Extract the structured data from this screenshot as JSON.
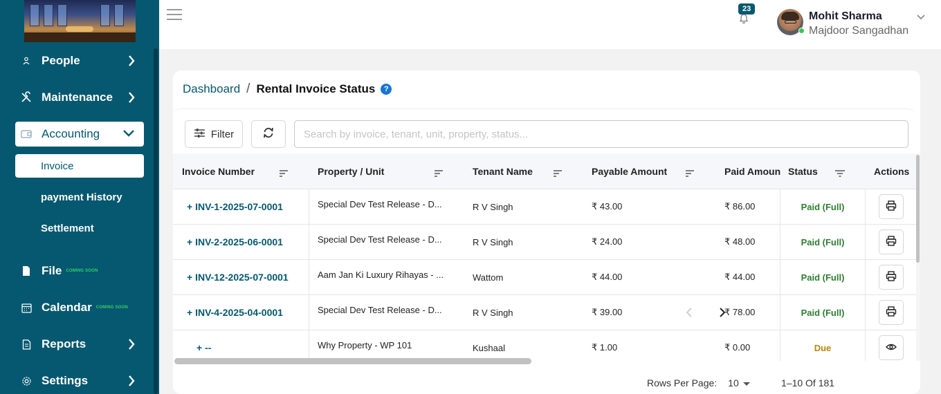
{
  "sidebar": {
    "items": [
      {
        "label": "People",
        "icon": "person-icon"
      },
      {
        "label": "Maintenance",
        "icon": "tools-icon"
      },
      {
        "label": "Accounting",
        "icon": "wallet-icon"
      },
      {
        "label": "File",
        "icon": "file-icon",
        "badge": "COMING SOON"
      },
      {
        "label": "Calendar",
        "icon": "calendar-icon",
        "badge": "COMING SOON"
      },
      {
        "label": "Reports",
        "icon": "report-icon"
      },
      {
        "label": "Settings",
        "icon": "gear-icon"
      }
    ],
    "sub_items": [
      {
        "label": "Invoice"
      },
      {
        "label": "payment History"
      },
      {
        "label": "Settlement"
      }
    ]
  },
  "header": {
    "notification_count": "23",
    "user_name": "Mohit Sharma",
    "user_org": "Majdoor Sangadhan"
  },
  "breadcrumb": {
    "root": "Dashboard",
    "separator": "/",
    "current": "Rental Invoice Status",
    "help": "?"
  },
  "toolbar": {
    "filter_label": "Filter",
    "search_placeholder": "Search by invoice, tenant, unit, property, status..."
  },
  "table": {
    "columns": [
      "Invoice Number",
      "Property / Unit",
      "Tenant Name",
      "Payable Amount",
      "Paid Amoun",
      "Status",
      "Actions"
    ],
    "rows": [
      {
        "invoice": "+ INV-1-2025-07-0001",
        "property": "Special Dev Test Release - D...",
        "tenant": "R V Singh",
        "payable": "₹ 43.00",
        "paid": "₹ 86.00",
        "status": "Paid (Full)",
        "action": "print"
      },
      {
        "invoice": "+ INV-2-2025-06-0001",
        "property": "Special Dev Test Release - D...",
        "tenant": "R V Singh",
        "payable": "₹ 24.00",
        "paid": "₹ 48.00",
        "status": "Paid (Full)",
        "action": "print"
      },
      {
        "invoice": "+ INV-12-2025-07-0001",
        "property": "Aam Jan Ki Luxury Rihayas - ...",
        "tenant": "Wattom",
        "payable": "₹ 44.00",
        "paid": "₹ 44.00",
        "status": "Paid (Full)",
        "action": "print"
      },
      {
        "invoice": "+ INV-4-2025-04-0001",
        "property": "Special Dev Test Release - D...",
        "tenant": "R V Singh",
        "payable": "₹ 39.00",
        "paid": "₹ 78.00",
        "status": "Paid (Full)",
        "action": "print"
      },
      {
        "invoice": "+ --",
        "property": "Why Property - WP 101",
        "tenant": "Kushaal",
        "payable": "₹ 1.00",
        "paid": "₹ 0.00",
        "status": "Due",
        "action": "view"
      }
    ]
  },
  "pagination": {
    "rows_per_page_label": "Rows Per Page:",
    "rows_per_page": "10",
    "range": "1–10 Of 181"
  },
  "colors": {
    "primary": "#05586f",
    "paid": "#2e7d32",
    "due": "#b8860b"
  }
}
